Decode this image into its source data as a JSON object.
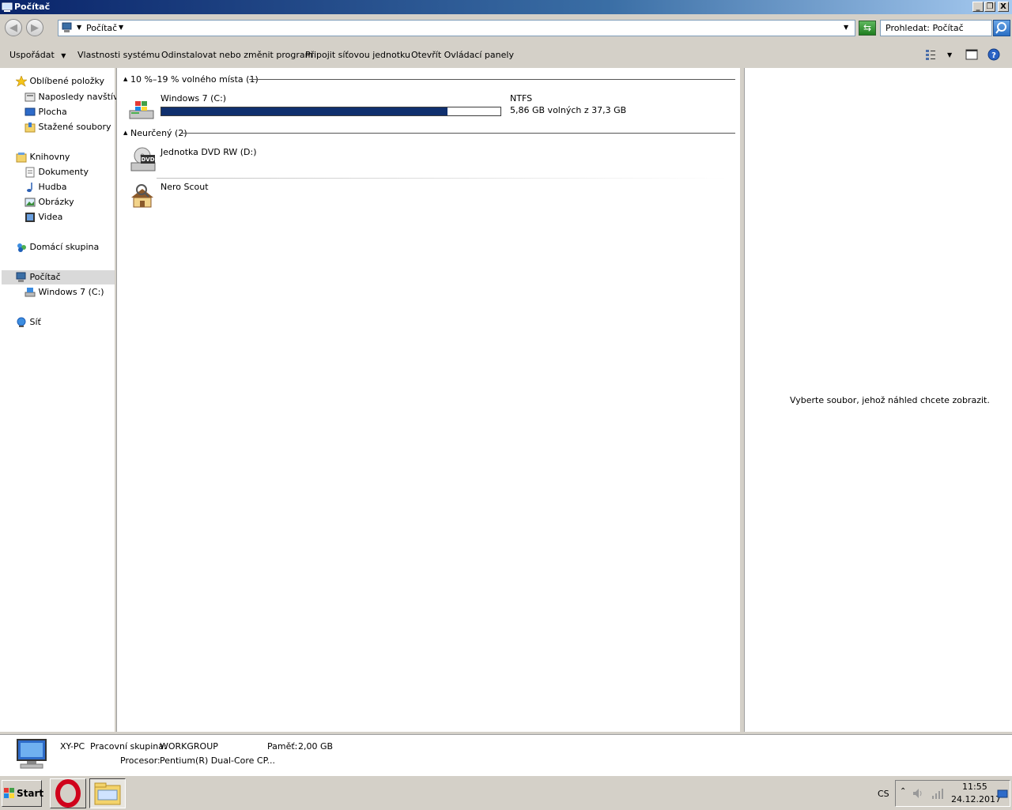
{
  "window": {
    "title": "Počítač",
    "controls": {
      "minimize": "_",
      "maximize": "❐",
      "close": "X"
    }
  },
  "address": {
    "location": "Počítač",
    "search_placeholder": "Prohledat: Počítač"
  },
  "toolbar": {
    "organize": "Uspořádat",
    "system_properties": "Vlastnosti systému",
    "uninstall": "Odinstalovat nebo změnit program",
    "map_drive": "Připojit síťovou jednotku",
    "control_panel": "Otevřít Ovládací panely"
  },
  "sidebar": {
    "favorites": "Oblíbené položky",
    "recent": "Naposledy navštíve",
    "desktop": "Plocha",
    "downloads": "Stažené soubory",
    "libraries": "Knihovny",
    "documents": "Dokumenty",
    "music": "Hudba",
    "pictures": "Obrázky",
    "videos": "Videa",
    "homegroup": "Domácí skupina",
    "computer": "Počítač",
    "drive_c": "Windows 7 (C:)",
    "network": "Síť"
  },
  "content": {
    "group1_header": "10 %–19 % volného místa (1)",
    "drive_c_name": "Windows 7 (C:)",
    "drive_c_fs": "NTFS",
    "drive_c_space": "5,86 GB volných z 37,3 GB",
    "drive_c_used_fraction": 0.843,
    "group2_header": "Neurčený (2)",
    "dvd_name": "Jednotka DVD RW (D:)",
    "dvd_badge": "DVD",
    "nero_name": "Nero Scout"
  },
  "preview": {
    "message": "Vyberte soubor, jehož náhled chcete zobrazit."
  },
  "details": {
    "pc_name": "XY-PC",
    "workgroup_label": "Pracovní skupina:",
    "workgroup_value": "WORKGROUP",
    "memory_label": "Paměť:",
    "memory_value": "2,00 GB",
    "processor_label": "Procesor:",
    "processor_value": "Pentium(R) Dual-Core  CP..."
  },
  "taskbar": {
    "start": "Start",
    "language": "CS",
    "time": "11:55",
    "date": "24.12.2017"
  },
  "colors": {
    "accent": "#0a246a",
    "progress": "#10306e"
  }
}
